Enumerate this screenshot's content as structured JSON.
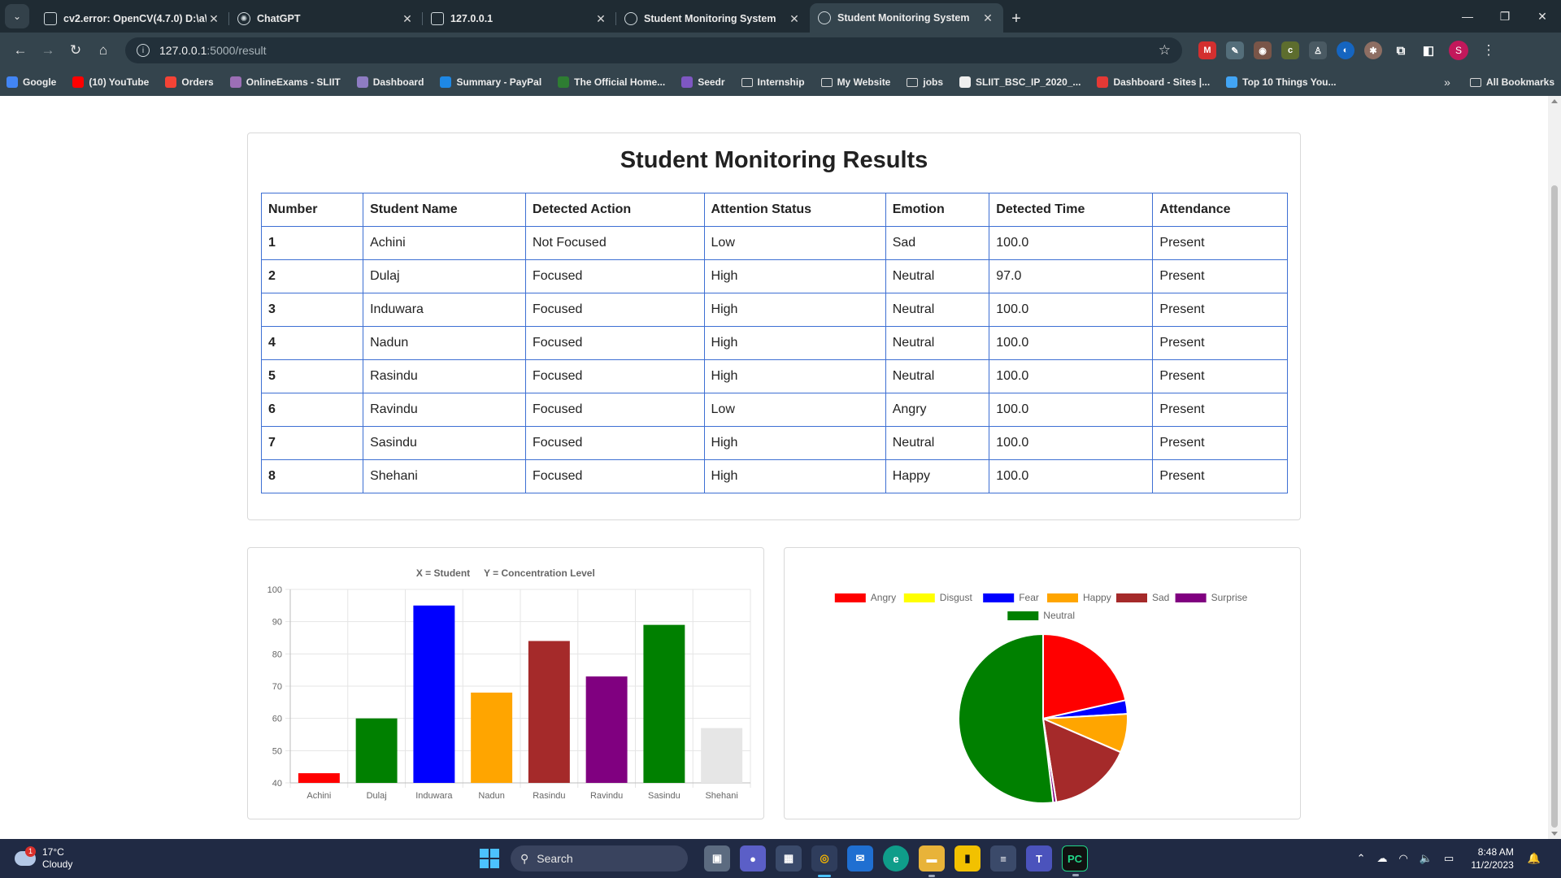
{
  "browser": {
    "tabs": [
      {
        "title": "cv2.error: OpenCV(4.7.0) D:\\a\\",
        "icon": "document-icon",
        "active": false
      },
      {
        "title": "ChatGPT",
        "icon": "chatgpt-icon",
        "active": false
      },
      {
        "title": "127.0.0.1",
        "icon": "document-icon",
        "active": false
      },
      {
        "title": "Student Monitoring System",
        "icon": "globe-icon",
        "active": false
      },
      {
        "title": "Student Monitoring System",
        "icon": "globe-icon",
        "active": true
      }
    ],
    "url_host": "127.0.0.1",
    "url_path": ":5000/result",
    "profile_initial": "S",
    "bookmarks": [
      {
        "label": "Google",
        "icon": "google-icon",
        "color": "#4285f4"
      },
      {
        "label": "(10) YouTube",
        "icon": "youtube-icon",
        "color": "#ff0000"
      },
      {
        "label": "Orders",
        "icon": "orders-icon",
        "color": "#f44336"
      },
      {
        "label": "OnlineExams - SLIIT",
        "icon": "sliit-icon",
        "color": "#9c6fb6"
      },
      {
        "label": "Dashboard",
        "icon": "dashboard-icon",
        "color": "#8e7cc3"
      },
      {
        "label": "Summary - PayPal",
        "icon": "paypal-icon",
        "color": "#1e88e5"
      },
      {
        "label": "The Official Home...",
        "icon": "leaf-icon",
        "color": "#2e7d32"
      },
      {
        "label": "Seedr",
        "icon": "seedr-icon",
        "color": "#7e57c2"
      },
      {
        "label": "Internship",
        "icon": "folder-icon",
        "color": ""
      },
      {
        "label": "My Website",
        "icon": "folder-icon",
        "color": ""
      },
      {
        "label": "jobs",
        "icon": "folder-icon",
        "color": ""
      },
      {
        "label": "SLIIT_BSC_IP_2020_...",
        "icon": "github-icon",
        "color": "#eeeeee"
      },
      {
        "label": "Dashboard - Sites |...",
        "icon": "sites-icon",
        "color": "#e53935"
      },
      {
        "label": "Top 10 Things You...",
        "icon": "bookmark-icon",
        "color": "#42a5f5"
      }
    ],
    "all_bookmarks_label": "All Bookmarks"
  },
  "page": {
    "title": "Student Monitoring Results",
    "table": {
      "headers": [
        "Number",
        "Student Name",
        "Detected Action",
        "Attention Status",
        "Emotion",
        "Detected Time",
        "Attendance"
      ],
      "rows": [
        [
          "1",
          "Achini",
          "Not Focused",
          "Low",
          "Sad",
          "100.0",
          "Present"
        ],
        [
          "2",
          "Dulaj",
          "Focused",
          "High",
          "Neutral",
          "97.0",
          "Present"
        ],
        [
          "3",
          "Induwara",
          "Focused",
          "High",
          "Neutral",
          "100.0",
          "Present"
        ],
        [
          "4",
          "Nadun",
          "Focused",
          "High",
          "Neutral",
          "100.0",
          "Present"
        ],
        [
          "5",
          "Rasindu",
          "Focused",
          "High",
          "Neutral",
          "100.0",
          "Present"
        ],
        [
          "6",
          "Ravindu",
          "Focused",
          "Low",
          "Angry",
          "100.0",
          "Present"
        ],
        [
          "7",
          "Sasindu",
          "Focused",
          "High",
          "Neutral",
          "100.0",
          "Present"
        ],
        [
          "8",
          "Shehani",
          "Focused",
          "High",
          "Happy",
          "100.0",
          "Present"
        ]
      ]
    }
  },
  "chart_data": [
    {
      "type": "bar",
      "legend_entries": [
        "X = Student",
        "Y = Concentration Level"
      ],
      "categories": [
        "Achini",
        "Dulaj",
        "Induwara",
        "Nadun",
        "Rasindu",
        "Ravindu",
        "Sasindu",
        "Shehani"
      ],
      "values": [
        43,
        60,
        95,
        68,
        84,
        73,
        89,
        57
      ],
      "colors": [
        "#ff0000",
        "#008000",
        "#0000ff",
        "#ffa500",
        "#a52a2a",
        "#800080",
        "#008000",
        "#e6e6e6"
      ],
      "ylim": [
        40,
        100
      ],
      "yticks": [
        "40",
        "50",
        "60",
        "70",
        "80",
        "90",
        "100"
      ],
      "grid": true
    },
    {
      "type": "pie",
      "legend_position": "top",
      "labels": [
        "Angry",
        "Disgust",
        "Fear",
        "Happy",
        "Sad",
        "Surprise",
        "Neutral"
      ],
      "values": [
        21.5,
        0,
        2.6,
        7.4,
        16.0,
        0.6,
        51.9
      ],
      "colors": [
        "#ff0000",
        "#ffff00",
        "#0000ff",
        "#ffa500",
        "#a52a2a",
        "#800080",
        "#008000"
      ]
    }
  ],
  "taskbar": {
    "temperature": "17°C",
    "condition": "Cloudy",
    "weather_badge": "1",
    "search_label": "Search",
    "time": "8:48 AM",
    "date": "11/2/2023"
  }
}
